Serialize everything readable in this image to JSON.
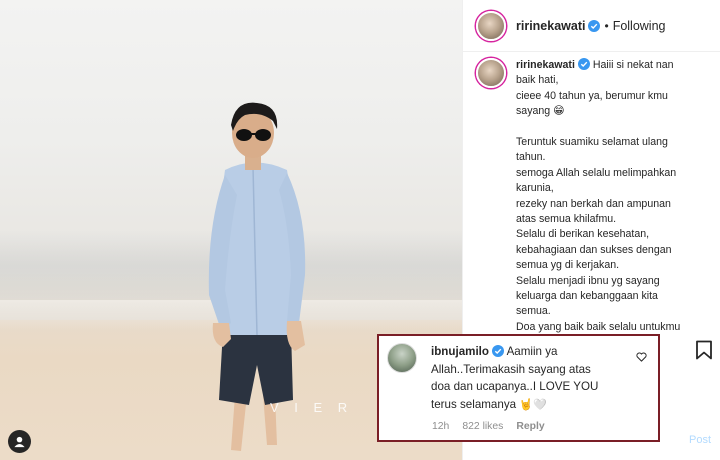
{
  "post": {
    "photo_watermark": "V I E R",
    "header": {
      "username": "ririnekawati",
      "follow_state": "Following"
    },
    "caption": {
      "username": "ririnekawati",
      "lines": [
        "Haiii si nekat nan",
        "baik hati,",
        "cieee 40 tahun ya, berumur kmu",
        "sayang",
        "",
        "Teruntuk suamiku selamat ulang",
        "tahun.",
        "semoga Allah selalu melimpahkan",
        "karunia,",
        "rezeky nan berkah dan ampunan",
        "atas semua khilafmu.",
        "Selalu di berikan kesehatan,",
        "kebahagiaan dan sukses dengan",
        "semua yg di kerjakan.",
        "Selalu menjadi ibnu yg sayang",
        "keluarga dan kebanggaan kita",
        "semua.",
        "Doa yang baik baik selalu untukmu",
        ""
      ],
      "emoji_after_sayang": "😁",
      "emoji_end": "🙏"
    },
    "comment": {
      "username": "ibnujamilo",
      "lines": [
        "Aamiin ya",
        "Allah..Terimakasih sayang atas",
        "doa dan ucapanya..I LOVE YOU",
        "terus selamanya"
      ],
      "emoji_end": "🤘🤍",
      "time": "12h",
      "likes": "822 likes",
      "reply_label": "Reply"
    },
    "post_button_label": "Post",
    "icons": {
      "verified": "verified-badge-icon",
      "heart": "heart-icon",
      "bookmark": "bookmark-icon",
      "user_tag": "user-tag-icon"
    },
    "colors": {
      "verified_blue": "#3897f0",
      "highlight_border": "#7a1e26",
      "post_button": "#b3dbff",
      "meta_gray": "#8e8e8e"
    }
  }
}
